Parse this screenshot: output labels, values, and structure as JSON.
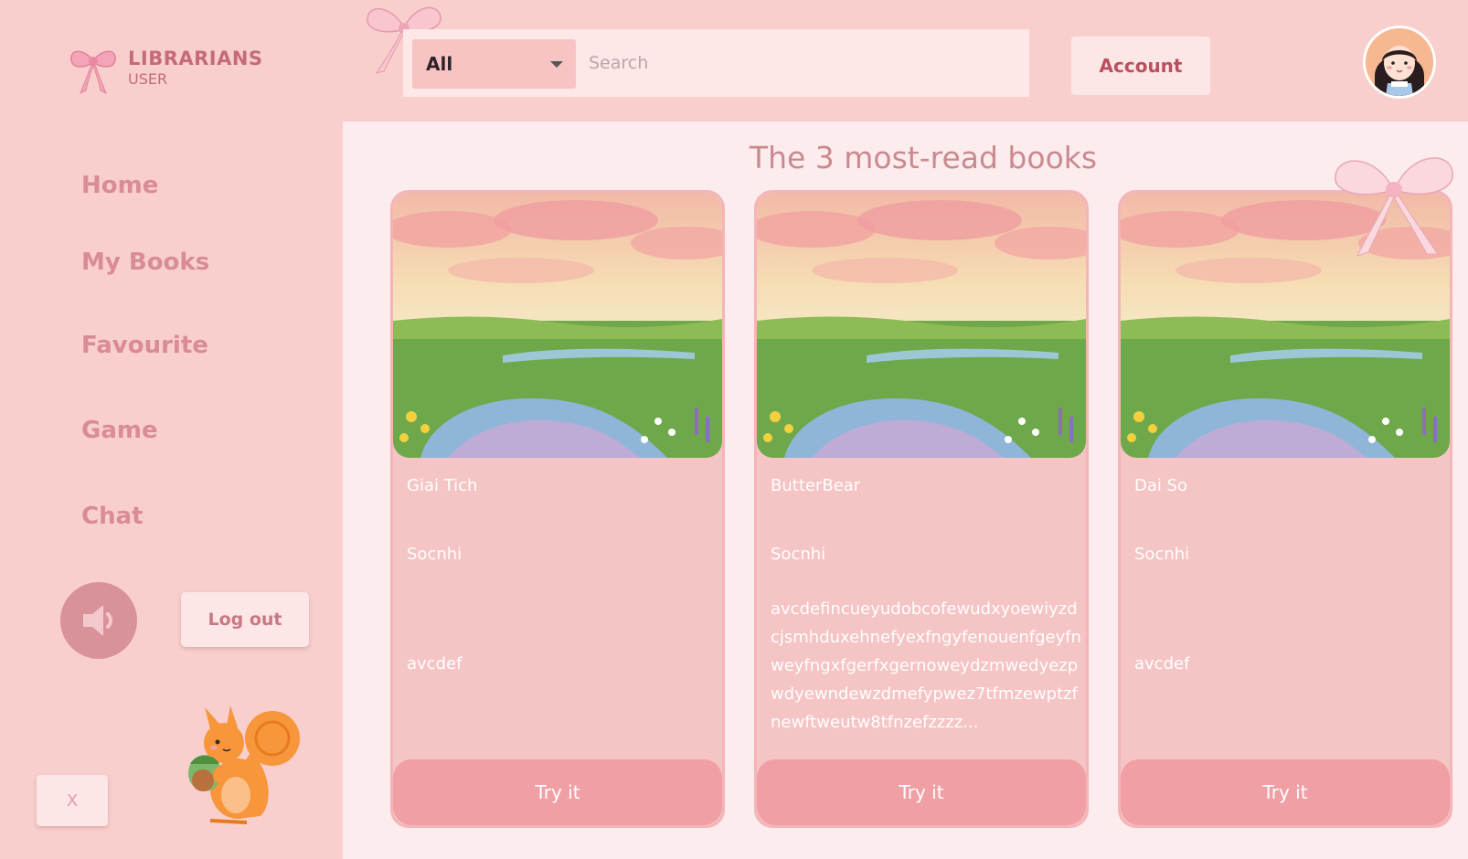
{
  "brand": {
    "title": "LIBRARIANS",
    "subtitle": "USER"
  },
  "nav": {
    "items": [
      {
        "label": "Home"
      },
      {
        "label": "My Books"
      },
      {
        "label": "Favourite"
      },
      {
        "label": "Game"
      },
      {
        "label": "Chat"
      }
    ]
  },
  "controls": {
    "logout_label": "Log out",
    "close_label": "X"
  },
  "search": {
    "category": "All",
    "placeholder": "Search"
  },
  "header": {
    "account_label": "Account"
  },
  "main": {
    "section_title": "The 3 most-read books",
    "books": [
      {
        "title": "Giai Tich",
        "author": "Socnhi",
        "description": "avcdef",
        "button": "Try it"
      },
      {
        "title": "ButterBear",
        "author": "Socnhi",
        "description": "avcdefincueyudobcofewudxyoewiyzdcjsmhduxehnefyexfngyfenouenfgeyfnweyfngxfgerfxgernoweydzmwedyezpwdyewndewzdmefypwez7tfmzewptzfnewftweutw8tfnzefzzzz...",
        "button": "Try it"
      },
      {
        "title": "Dai So",
        "author": "Socnhi",
        "description": "avcdef",
        "button": "Try it"
      }
    ]
  },
  "colors": {
    "background": "#f8cfcd",
    "main_bg": "#fdeced",
    "card_bg": "#f5c4c5",
    "button_bg": "#f0a0a5",
    "accent_text": "#c56b78"
  },
  "icons": [
    "bow-icon",
    "chevron-down-icon",
    "speaker-icon",
    "squirrel-illustration",
    "avatar"
  ]
}
